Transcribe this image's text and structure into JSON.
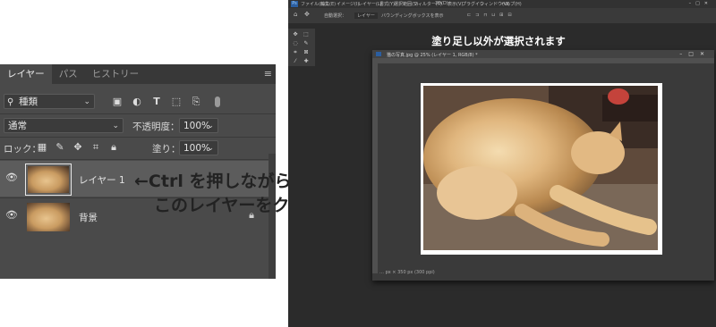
{
  "layers_panel": {
    "tabs": [
      {
        "label": "レイヤー",
        "active": true
      },
      {
        "label": "パス",
        "active": false
      },
      {
        "label": "ヒストリー",
        "active": false
      }
    ],
    "menu_icon": "panel-menu-icon",
    "filter": {
      "label": "種類",
      "search_icon": "search-icon"
    },
    "filter_icons": [
      "image-filter-icon",
      "adjustment-filter-icon",
      "type-filter-icon",
      "shape-filter-icon",
      "smart-object-filter-icon",
      "filter-toggle-icon"
    ],
    "blend_mode": "通常",
    "opacity_label": "不透明度：",
    "opacity_value": "100%",
    "lock_label": "ロック：",
    "lock_icons": [
      "lock-transparent-icon",
      "lock-image-icon",
      "lock-position-icon",
      "lock-artboard-icon",
      "lock-all-icon"
    ],
    "fill_label": "塗り：",
    "fill_value": "100%",
    "layers": [
      {
        "name": "レイヤー 1",
        "selected": true,
        "locked": false
      },
      {
        "name": "背景",
        "selected": false,
        "locked": true
      }
    ]
  },
  "annotation": {
    "line1": "←Ctrl を押しながら",
    "line2": "このレイヤーをクリック"
  },
  "photoshop": {
    "notice": "塗り足し以外が選択されます",
    "menu": [
      "ファイル(F)",
      "編集(E)",
      "イメージ(I)",
      "レイヤー(L)",
      "書式(Y)",
      "選択範囲(S)",
      "フィルター(T)",
      "3D(D)",
      "表示(V)",
      "プラグイン",
      "ウィンドウ(W)",
      "ヘルプ(H)"
    ],
    "options": [
      "自動選択：",
      "レイヤー",
      "バウンディングボックスを表示"
    ],
    "document": {
      "title": "猫の写真.jpg @ 25% (レイヤー 1, RGB/8) *",
      "status": "… px × 350 px (300 ppi)"
    },
    "colors": {
      "app_bg": "#2b2b2b",
      "panel_bg": "#4a4a4a",
      "selected_layer": "#5c5c5c",
      "ps_blue": "#2b5ea0"
    }
  }
}
